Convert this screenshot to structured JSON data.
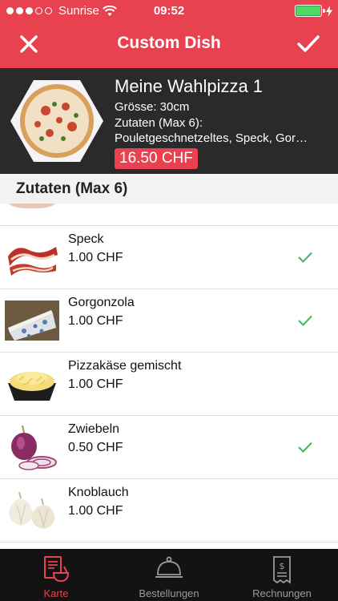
{
  "status": {
    "carrier": "Sunrise",
    "time": "09:52"
  },
  "nav": {
    "title": "Custom Dish",
    "close_icon": "close-icon",
    "confirm_icon": "checkmark-icon"
  },
  "dish": {
    "name": "Meine Wahlpizza 1",
    "size": "Grösse:  30cm",
    "ingredients_label": "Zutaten (Max 6):",
    "ingredients_list": "Pouletgeschnetzeltes, Speck, Gor…",
    "price": "16.50 CHF"
  },
  "section": {
    "title": "Zutaten (Max 6)"
  },
  "ingredients": [
    {
      "name": "Speck",
      "price": "1.00 CHF",
      "selected": true
    },
    {
      "name": "Gorgonzola",
      "price": "1.00 CHF",
      "selected": true
    },
    {
      "name": "Pizzakäse gemischt",
      "price": "1.00 CHF",
      "selected": false
    },
    {
      "name": "Zwiebeln",
      "price": "0.50 CHF",
      "selected": true
    },
    {
      "name": "Knoblauch",
      "price": "1.00 CHF",
      "selected": false
    }
  ],
  "tabs": [
    {
      "label": "Karte",
      "active": true
    },
    {
      "label": "Bestellungen",
      "active": false
    },
    {
      "label": "Rechnungen",
      "active": false
    }
  ],
  "colors": {
    "accent": "#e8414f",
    "check": "#3fb562",
    "header_dark": "#2a2a2c",
    "tabbar": "#131313"
  }
}
